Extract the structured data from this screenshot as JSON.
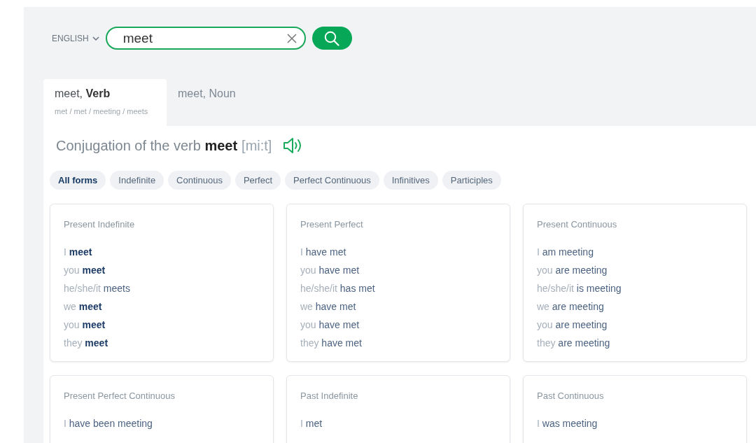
{
  "language": {
    "label": "ENGLISH"
  },
  "search": {
    "value": "meet"
  },
  "tabs": [
    {
      "label": "meet, **Verb**",
      "forms": "met / met / meeting / meets",
      "selected": true
    },
    {
      "label": "meet, Noun",
      "selected": false
    }
  ],
  "heading": {
    "text": "Conjugation of the verb **meet**",
    "transcription": "[mi:t]"
  },
  "filters": [
    {
      "label": "All forms",
      "selected": true
    },
    {
      "label": "Indefinite",
      "selected": false
    },
    {
      "label": "Continuous",
      "selected": false
    },
    {
      "label": "Perfect",
      "selected": false
    },
    {
      "label": "Perfect Continuous",
      "selected": false
    },
    {
      "label": "Infinitives",
      "selected": false
    },
    {
      "label": "Participles",
      "selected": false
    }
  ],
  "cards": [
    {
      "title": "Present Indefinite",
      "forms": [
        {
          "pronoun": "I",
          "verb": "meet",
          "highlighted": true
        },
        {
          "pronoun": "you",
          "verb": "meet",
          "highlighted": true
        },
        {
          "pronoun": "he/she/it",
          "verb": "meets",
          "highlighted": false
        },
        {
          "pronoun": "we",
          "verb": "meet",
          "highlighted": true
        },
        {
          "pronoun": "you",
          "verb": "meet",
          "highlighted": true
        },
        {
          "pronoun": "they",
          "verb": "meet",
          "highlighted": true
        }
      ]
    },
    {
      "title": "Present Perfect",
      "forms": [
        {
          "pronoun": "I",
          "verb": "have met",
          "highlighted": false
        },
        {
          "pronoun": "you",
          "verb": "have met",
          "highlighted": false
        },
        {
          "pronoun": "he/she/it",
          "verb": "has met",
          "highlighted": false
        },
        {
          "pronoun": "we",
          "verb": "have met",
          "highlighted": false
        },
        {
          "pronoun": "you",
          "verb": "have met",
          "highlighted": false
        },
        {
          "pronoun": "they",
          "verb": "have met",
          "highlighted": false
        }
      ]
    },
    {
      "title": "Present Continuous",
      "forms": [
        {
          "pronoun": "I",
          "verb": "am meeting",
          "highlighted": false
        },
        {
          "pronoun": "you",
          "verb": "are meeting",
          "highlighted": false
        },
        {
          "pronoun": "he/she/it",
          "verb": "is meeting",
          "highlighted": false
        },
        {
          "pronoun": "we",
          "verb": "are meeting",
          "highlighted": false
        },
        {
          "pronoun": "you",
          "verb": "are meeting",
          "highlighted": false
        },
        {
          "pronoun": "they",
          "verb": "are meeting",
          "highlighted": false
        }
      ]
    },
    {
      "title": "Present Perfect Continuous",
      "forms": [
        {
          "pronoun": "I",
          "verb": "have been meeting",
          "highlighted": false
        }
      ]
    },
    {
      "title": "Past Indefinite",
      "forms": [
        {
          "pronoun": "I",
          "verb": "met",
          "highlighted": false
        }
      ]
    },
    {
      "title": "Past Continuous",
      "forms": [
        {
          "pronoun": "I",
          "verb": "was meeting",
          "highlighted": false
        }
      ]
    }
  ]
}
